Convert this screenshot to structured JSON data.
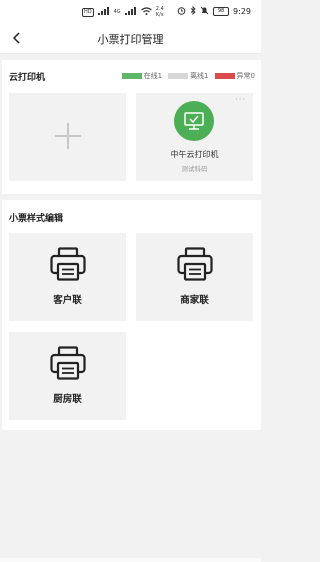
{
  "status_bar": {
    "sim1": "HD",
    "sim2": "4G",
    "speed": "2.4",
    "speed_unit": "K/s",
    "battery": "98",
    "time": "9:29"
  },
  "header": {
    "title": "小票打印管理"
  },
  "printer_section": {
    "title": "云打印机",
    "legend": [
      {
        "label": "在线1",
        "color": "#5db767"
      },
      {
        "label": "离线1",
        "color": "#d6d6d6"
      },
      {
        "label": "异常0",
        "color": "#d94c4c"
      }
    ],
    "printer": {
      "name": "中午云打印机",
      "subtitle": "测试科码",
      "more": "···",
      "status_color": "#4cae55"
    }
  },
  "style_section": {
    "title": "小票样式编辑",
    "items": [
      {
        "label": "客户联",
        "icon": "printer-icon"
      },
      {
        "label": "商家联",
        "icon": "printer-icon"
      },
      {
        "label": "厨房联",
        "icon": "printer-icon"
      }
    ]
  }
}
